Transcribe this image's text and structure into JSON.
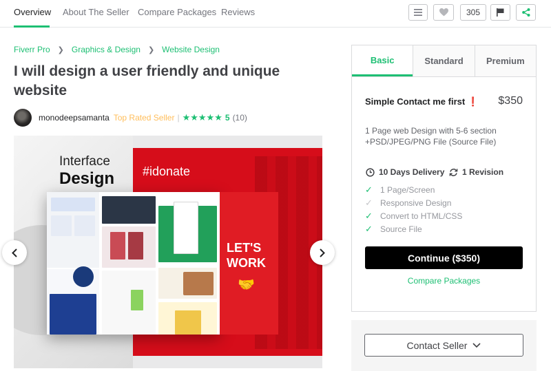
{
  "nav": {
    "tabs": [
      "Overview",
      "About The Seller",
      "Compare Packages",
      "Reviews"
    ],
    "like_count": "305",
    "icons": [
      "list-icon",
      "heart-icon",
      "flag-icon",
      "share-icon"
    ]
  },
  "breadcrumb": [
    "Fiverr Pro",
    "Graphics & Design",
    "Website Design"
  ],
  "gig": {
    "title": "I will design a user friendly and unique website"
  },
  "seller": {
    "name": "monodeepsamanta",
    "level": "Top Rated Seller",
    "stars": "★★★★★",
    "rating": "5",
    "reviews": "(10)"
  },
  "gallery": {
    "heading_line1": "Interface",
    "heading_line2": "Design",
    "hashtag": "#idonate",
    "cta_line1": "LET'S",
    "cta_line2": "WORK"
  },
  "package": {
    "tabs": [
      "Basic",
      "Standard",
      "Premium"
    ],
    "active_tab": "Basic",
    "title": "Simple Contact me first",
    "title_emoji": "❗",
    "price": "$350",
    "description": "1 Page web Design with 5-6 section +PSD/JPEG/PNG File (Source File)",
    "delivery": "10 Days Delivery",
    "revisions": "1 Revision",
    "features": [
      {
        "label": "1 Page/Screen",
        "included": true
      },
      {
        "label": "Responsive Design",
        "included": false
      },
      {
        "label": "Convert to HTML/CSS",
        "included": true
      },
      {
        "label": "Source File",
        "included": true
      }
    ],
    "continue_label": "Continue ($350)",
    "compare_label": "Compare Packages"
  },
  "contact": {
    "label": "Contact Seller"
  },
  "colors": {
    "accent": "#1dbf73",
    "top_rated": "#ffbe5b",
    "gallery_red": "#d60d1a"
  }
}
